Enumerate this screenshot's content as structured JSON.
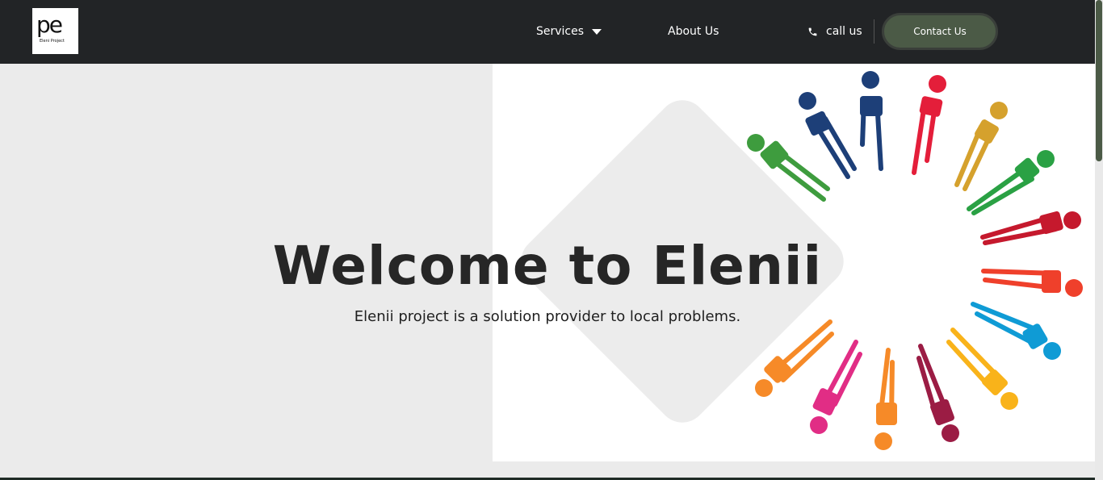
{
  "logo": {
    "mark": "pe",
    "text": "Eleni Project"
  },
  "nav": {
    "services_label": "Services",
    "about_label": "About Us",
    "call_label": "call us",
    "contact_label": "Contact Us"
  },
  "hero": {
    "title": "Welcome to Elenii",
    "subtitle": "Elenii project is a solution provider to local problems."
  },
  "icons": [
    "caret-down-icon",
    "phone-icon"
  ],
  "colors": {
    "nav_bg": "#222426",
    "accent": "#4b5a46",
    "hero_bg": "#ebebeb",
    "figures": [
      "#1d3f78",
      "#e41e3a",
      "#d5a12d",
      "#2aa144",
      "#c5192d",
      "#ef402b",
      "#0f9bd5",
      "#f9b31a",
      "#e12d85",
      "#f68a28",
      "#9b1c44",
      "#3e9c3e"
    ]
  }
}
